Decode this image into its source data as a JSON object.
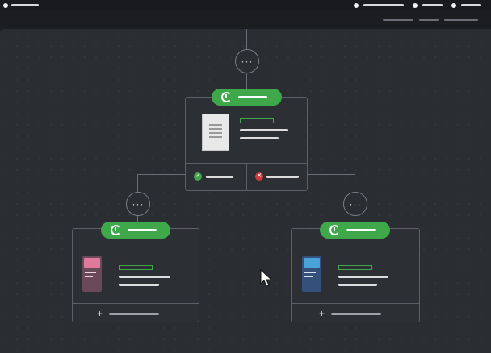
{
  "header": {
    "title": "",
    "nav": []
  },
  "workflow": {
    "top_action_icon": "more-icon",
    "root": {
      "trigger_icon": "timer-icon",
      "status_colors": {
        "trigger": "#3ea84a",
        "success": "#3ea84a",
        "failure": "#d23b3b"
      }
    },
    "more_label": "···"
  },
  "icons": {
    "check": "✓",
    "cross": "✕",
    "plus": "+"
  }
}
